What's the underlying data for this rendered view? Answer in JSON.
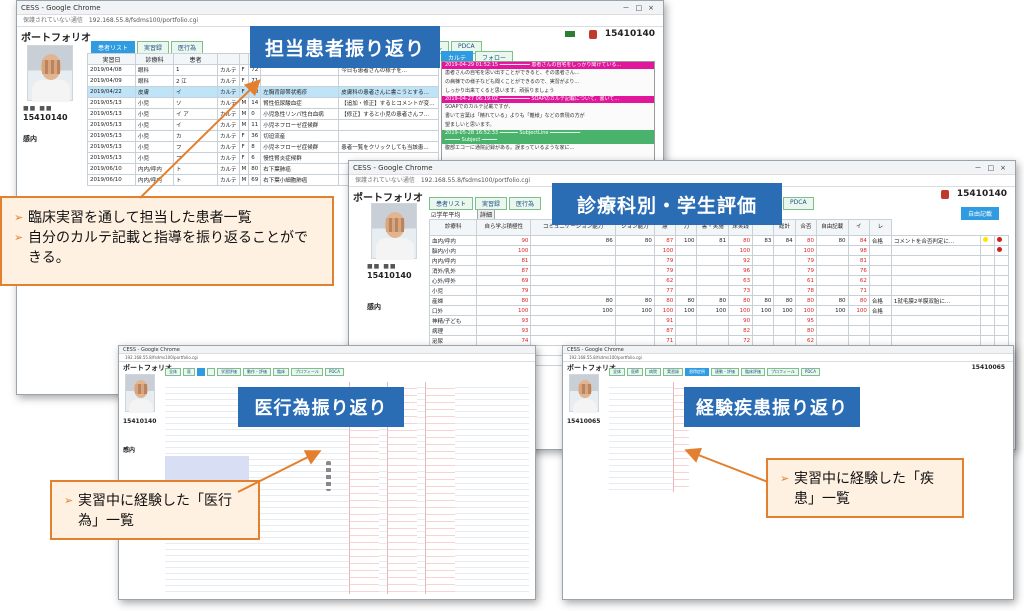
{
  "browser": {
    "title": "CESS - Google Chrome",
    "insecure": "保護されていない通信",
    "url": "192.168.55.8/fsdms100/portfolio.cgi"
  },
  "portfolio": {
    "title": "ポートフォリオ",
    "student_id": "15410140",
    "student_name_obscured": "■■ ■■",
    "section_label": "感内"
  },
  "win1": {
    "tabs": [
      "患者リスト",
      "実習録",
      "医行為",
      "",
      "",
      "",
      "ール",
      "PDCA"
    ],
    "sub_tabs": [
      "カルテ",
      "フォロー"
    ],
    "headers": [
      "実習日",
      "診療科",
      "患者",
      "カルテ",
      "性",
      "年齢",
      "病名",
      "コメント"
    ],
    "rows": [
      {
        "date": "2019/04/08",
        "dept": "眼科",
        "patient": "1",
        "karte": "カルテ",
        "sex": "F",
        "age": "72",
        "disease": "",
        "comment": "今日も患者さんの様子を..."
      },
      {
        "date": "2019/04/09",
        "dept": "眼科",
        "patient": "2 江",
        "karte": "カルテ",
        "sex": "F",
        "age": "71",
        "disease": "",
        "comment": ""
      },
      {
        "date": "2019/04/22",
        "dept": "皮膚",
        "patient": "イ",
        "karte": "カルテ",
        "sex": "F",
        "age": "70",
        "disease": "左胸背部帯状疱疹",
        "comment": "皮膚科の患者さんに書こうとする..."
      },
      {
        "date": "2019/05/13",
        "dept": "小児",
        "patient": "ソ",
        "karte": "カルテ",
        "sex": "M",
        "age": "14",
        "disease": "腎性低尿酸血症",
        "comment": "【追加・修正】するとコメントが変..."
      },
      {
        "date": "2019/05/13",
        "dept": "小児",
        "patient": "イ ア",
        "karte": "カルテ",
        "sex": "M",
        "age": "0",
        "disease": "小児急性リンパ性白血病",
        "comment": "【修正】すると小児の患者さんフ..."
      },
      {
        "date": "2019/05/13",
        "dept": "小児",
        "patient": "イ",
        "karte": "カルテ",
        "sex": "M",
        "age": "11",
        "disease": "小児ネフローゼ症候群",
        "comment": ""
      },
      {
        "date": "2019/05/13",
        "dept": "小児",
        "patient": "カ",
        "karte": "カルテ",
        "sex": "F",
        "age": "36",
        "disease": "切迫流産",
        "comment": ""
      },
      {
        "date": "2019/05/13",
        "dept": "小児",
        "patient": "フ",
        "karte": "カルテ",
        "sex": "F",
        "age": "8",
        "disease": "小児ネフローゼ症候群",
        "comment": "患者一覧をクリックしても当該患..."
      },
      {
        "date": "2019/05/13",
        "dept": "小児",
        "patient": "フ",
        "karte": "カルテ",
        "sex": "F",
        "age": "6",
        "disease": "慢性腎炎症候群",
        "comment": ""
      },
      {
        "date": "2019/06/10",
        "dept": "内内/呼内",
        "patient": "ト",
        "karte": "カルテ",
        "sex": "M",
        "age": "80",
        "disease": "右下葉肺癌",
        "comment": ""
      },
      {
        "date": "2019/06/10",
        "dept": "内内/呼内",
        "patient": "ト",
        "karte": "カルテ",
        "sex": "M",
        "age": "69",
        "disease": "右下葉小細胞肺癌",
        "comment": ""
      }
    ],
    "log": [
      {
        "bar": "2019-04-29 01:52:15 ━━━━━━━━━━ 患者さんの自宅をしっかり聞けている..."
      },
      {
        "text": "患者さんの自宅を思い出すことができると、その患者さん..."
      },
      {
        "text": "の病棟での様子なども聞くことができるので、実習がより..."
      },
      {
        "text": "しっかり出来てくると思います。頑張りましょう"
      },
      {
        "bar": "2019-04-27 06:19:02 ━━━━━━━━━━ SOAPのカルテ記載について、書いて..."
      },
      {
        "text": "SOAPでのカルテ記載ですが、"
      },
      {
        "text": "書いて言葉は「精れている」よりも「離様」などの表現の方が"
      },
      {
        "text": "望ましいと思います。"
      },
      {
        "green": "2019-05-28 16:52:33 ━━━━━━ SubjectLine ━━━━━━━━━━"
      },
      {
        "green": "━━━━━ Subject ━━━━━"
      },
      {
        "text": "腹部エコーに通院記録がある。誤まっているような家に..."
      }
    ]
  },
  "win2": {
    "tabs": [
      "患者リスト",
      "実習録",
      "医行為",
      "",
      "",
      "",
      "ール",
      "PDCA"
    ],
    "checkbox_label": "☑学年平均",
    "detail_button": "詳細",
    "free_button": "自由記載",
    "headers": [
      "診療科",
      "自ら学ぶ積極性",
      "コミュニケーション能力",
      "ション能力",
      "慮",
      "力",
      "書・実施",
      "床実践",
      "",
      "総計",
      "合否",
      "自由記載",
      "イ",
      "レ"
    ],
    "rows": [
      {
        "dept": "血内/呼内",
        "v": [
          "90",
          "86",
          "80",
          "87",
          "100",
          "81",
          "80",
          "83",
          "84",
          "80",
          "80"
        ],
        "total": "80",
        "hue": "84",
        "pass": "合格",
        "free": "コメントを合否判定に...",
        "dots": "yr"
      },
      {
        "dept": "脳内/小内",
        "v": [
          "100",
          "",
          "",
          "100",
          "",
          "",
          "100",
          "",
          "",
          "100",
          ""
        ],
        "total": "",
        "hue": "98",
        "pass": "",
        "free": "",
        "dots": "r"
      },
      {
        "dept": "内内/呼内",
        "v": [
          "81",
          "",
          "",
          "79",
          "",
          "",
          "92",
          "",
          "",
          "79",
          ""
        ],
        "total": "",
        "hue": "81",
        "pass": "",
        "free": "",
        "dots": ""
      },
      {
        "dept": "消外/乳外",
        "v": [
          "87",
          "",
          "",
          "79",
          "",
          "",
          "96",
          "",
          "",
          "79",
          ""
        ],
        "total": "",
        "hue": "76",
        "pass": "",
        "free": "",
        "dots": ""
      },
      {
        "dept": "心外/呼外",
        "v": [
          "69",
          "",
          "",
          "62",
          "",
          "",
          "63",
          "",
          "",
          "61",
          ""
        ],
        "total": "",
        "hue": "62",
        "pass": "",
        "free": "",
        "dots": ""
      },
      {
        "dept": "小児",
        "v": [
          "79",
          "",
          "",
          "77",
          "",
          "",
          "73",
          "",
          "",
          "78",
          ""
        ],
        "total": "",
        "hue": "71",
        "pass": "",
        "free": "",
        "dots": ""
      },
      {
        "dept": "産婦",
        "v": [
          "80",
          "80",
          "80",
          "80",
          "80",
          "80",
          "80",
          "80",
          "80",
          "80",
          "80"
        ],
        "total": "80",
        "hue": "80",
        "pass": "合格",
        "free": "1就毛膜2羊膜双胎に...",
        "dots": ""
      },
      {
        "dept": "口外",
        "v": [
          "100",
          "100",
          "100",
          "100",
          "100",
          "100",
          "100",
          "100",
          "100",
          "100",
          "100"
        ],
        "total": "100",
        "hue": "100",
        "pass": "合格",
        "free": "",
        "dots": ""
      },
      {
        "dept": "神精/子ども",
        "v": [
          "93",
          "",
          "",
          "91",
          "",
          "",
          "90",
          "",
          "",
          "95",
          ""
        ],
        "total": "",
        "hue": "",
        "pass": "",
        "free": "",
        "dots": ""
      },
      {
        "dept": "病理",
        "v": [
          "93",
          "",
          "",
          "87",
          "",
          "",
          "82",
          "",
          "",
          "80",
          ""
        ],
        "total": "",
        "hue": "",
        "pass": "",
        "free": "",
        "dots": ""
      },
      {
        "dept": "泌尿",
        "v": [
          "74",
          "",
          "",
          "71",
          "",
          "",
          "72",
          "",
          "",
          "62",
          ""
        ],
        "total": "",
        "hue": "",
        "pass": "",
        "free": "",
        "dots": ""
      },
      {
        "dept": "整形",
        "v": [
          "84",
          "",
          "",
          "80",
          "",
          "",
          "85",
          "",
          "",
          "91",
          ""
        ],
        "total": "",
        "hue": "",
        "pass": "",
        "free": "",
        "dots": ""
      },
      {
        "dept": "脳外",
        "v": [
          "70",
          "",
          "",
          "63",
          "",
          "",
          "65",
          "",
          "",
          "72",
          ""
        ],
        "total": "",
        "hue": "",
        "pass": "",
        "free": "",
        "dots": ""
      }
    ]
  },
  "win3": {
    "title": "CESS - Google Chrome",
    "student_id": "15410140",
    "tabs": [
      "全体",
      "医",
      "",
      "",
      "学習評価",
      "動作・評価",
      "臨床",
      "プロフィール",
      "PDCA"
    ]
  },
  "win4": {
    "title": "CESS - Google Chrome",
    "student_id": "15410065",
    "tabs": [
      "全体",
      "医師",
      "病院",
      "実習録",
      "習得症例",
      "連動・評価",
      "臨床評価",
      "プロフィール",
      "PDCA"
    ]
  },
  "callouts": {
    "c1": "担当患者振り返り",
    "c2": "診療科別・学生評価",
    "c3": "医行為振り返り",
    "c4": "経験疾患振り返り"
  },
  "notes": {
    "n1": [
      "臨床実習を通して担当した患者一覧",
      "自分のカルテ記載と指導を振り返ることができる。"
    ],
    "n2": [
      "実習中に経験した「医行為」一覧"
    ],
    "n3": [
      "実習中に経験した「疾患」一覧"
    ]
  },
  "colors": {
    "callout": "#2a6db5",
    "note_bg": "#fff1e2",
    "note_border": "#e2802f",
    "arrow": "#e2802f",
    "tab_active": "#2f9be0",
    "highlight_row": "#bfe3f7"
  }
}
